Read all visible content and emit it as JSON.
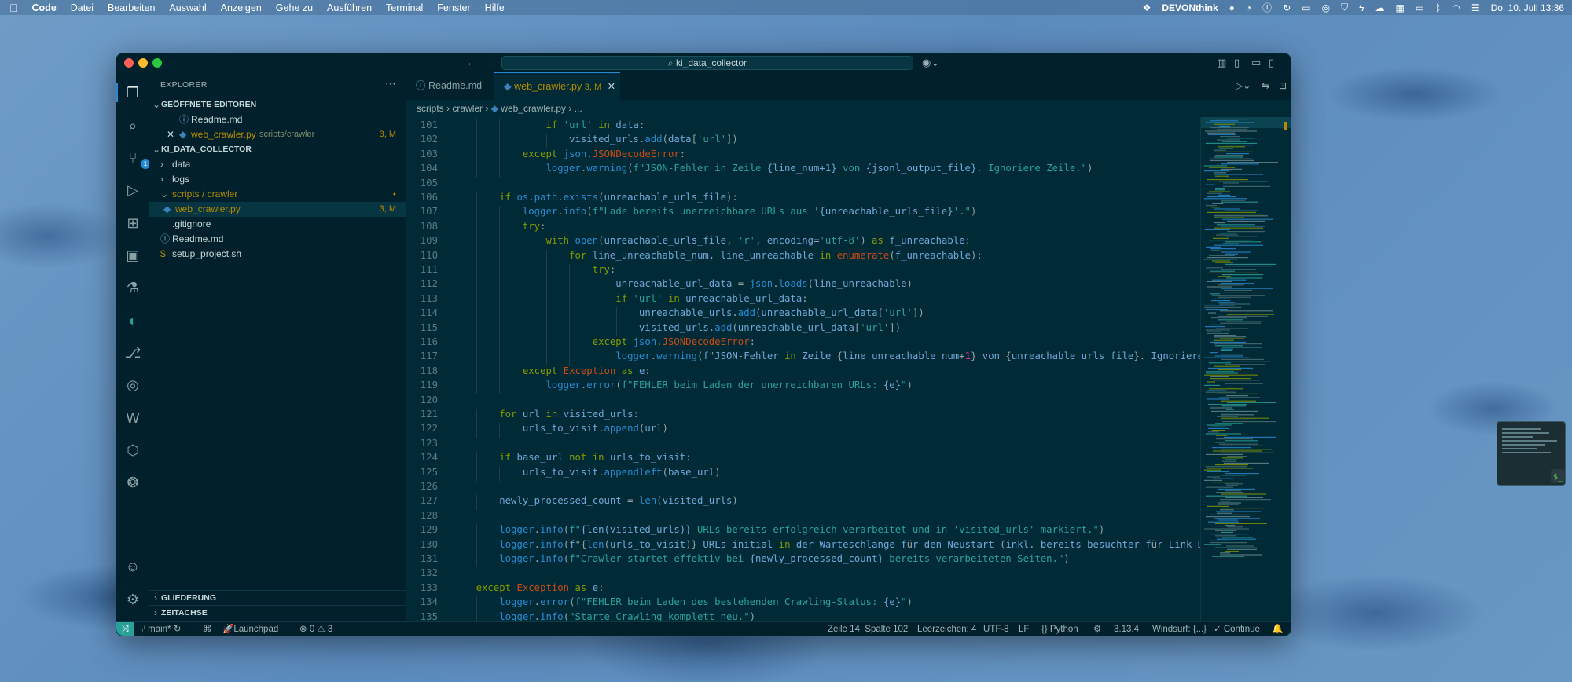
{
  "menubar": {
    "app": "Code",
    "menus": [
      "Datei",
      "Bearbeiten",
      "Auswahl",
      "Anzeigen",
      "Gehe zu",
      "Ausführen",
      "Terminal",
      "Fenster",
      "Hilfe"
    ],
    "devonthink": "DEVONthink",
    "clock": "Do. 10. Juli  13:36"
  },
  "window": {
    "command_center": "ki_data_collector"
  },
  "sidebar": {
    "title": "EXPLORER",
    "open_editors_label": "GEÖFFNETE EDITOREN",
    "open_editors": [
      {
        "name": "Readme.md",
        "path": "",
        "status": ""
      },
      {
        "name": "web_crawler.py",
        "path": "scripts/crawler",
        "status": "3, M"
      }
    ],
    "project_label": "KI_DATA_COLLECTOR",
    "tree": [
      {
        "name": "data",
        "status": ""
      },
      {
        "name": "logs",
        "status": ""
      },
      {
        "name": "scripts / crawler",
        "status": "●"
      },
      {
        "name": "web_crawler.py",
        "status": "3, M"
      },
      {
        "name": ".gitignore",
        "status": ""
      },
      {
        "name": "Readme.md",
        "status": ""
      },
      {
        "name": "setup_project.sh",
        "status": ""
      }
    ],
    "outline_label": "GLIEDERUNG",
    "timeline_label": "ZEITACHSE"
  },
  "tabs": [
    {
      "label": "Readme.md",
      "status": ""
    },
    {
      "label": "web_crawler.py",
      "status": "3, M"
    }
  ],
  "breadcrumb": {
    "seg1": "scripts",
    "seg2": "crawler",
    "seg3": "web_crawler.py",
    "seg4": "..."
  },
  "editor": {
    "line_numbers": [
      "101",
      "102",
      "103",
      "104",
      "105",
      "106",
      "107",
      "108",
      "109",
      "110",
      "111",
      "112",
      "113",
      "114",
      "115",
      "116",
      "117",
      "118",
      "119",
      "120",
      "121",
      "122",
      "123",
      "124",
      "125",
      "126",
      "127",
      "128",
      "129",
      "130",
      "131",
      "132",
      "133",
      "134",
      "135"
    ],
    "lines": [
      "                if 'url' in data:",
      "                    visited_urls.add(data['url'])",
      "            except json.JSONDecodeError:",
      "                logger.warning(f\"JSON-Fehler in Zeile {line_num+1} von {jsonl_output_file}. Ignoriere Zeile.\")",
      "",
      "        if os.path.exists(unreachable_urls_file):",
      "            logger.info(f\"Lade bereits unerreichbare URLs aus '{unreachable_urls_file}'.\")",
      "            try:",
      "                with open(unreachable_urls_file, 'r', encoding='utf-8') as f_unreachable:",
      "                    for line_unreachable_num, line_unreachable in enumerate(f_unreachable):",
      "                        try:",
      "                            unreachable_url_data = json.loads(line_unreachable)",
      "                            if 'url' in unreachable_url_data:",
      "                                unreachable_urls.add(unreachable_url_data['url'])",
      "                                visited_urls.add(unreachable_url_data['url'])",
      "                        except json.JSONDecodeError:",
      "                            logger.warning(f\"JSON-Fehler in Zeile {line_unreachable_num+1} von {unreachable_urls_file}. Ignoriere",
      "            except Exception as e:",
      "                logger.error(f\"FEHLER beim Laden der unerreichbaren URLs: {e}\")",
      "",
      "        for url in visited_urls:",
      "            urls_to_visit.append(url)",
      "",
      "        if base_url not in urls_to_visit:",
      "            urls_to_visit.appendleft(base_url)",
      "",
      "        newly_processed_count = len(visited_urls)",
      "",
      "        logger.info(f\"{len(visited_urls)} URLs bereits erfolgreich verarbeitet und in 'visited_urls' markiert.\")",
      "        logger.info(f\"{len(urls_to_visit)} URLs initial in der Warteschlange für den Neustart (inkl. bereits besuchter für Link-D",
      "        logger.info(f\"Crawler startet effektiv bei {newly_processed_count} bereits verarbeiteten Seiten.\")",
      "",
      "    except Exception as e:",
      "        logger.error(f\"FEHLER beim Laden des bestehenden Crawling-Status: {e}\")",
      "        logger.info(\"Starte Crawling komplett neu.\")"
    ]
  },
  "statusbar": {
    "branch": "main*",
    "launchpad": "Launchpad",
    "problems": "⊗ 0 ⚠ 3",
    "cursor": "Zeile 14, Spalte 102",
    "spaces": "Leerzeichen: 4",
    "encoding": "UTF-8",
    "eol": "LF",
    "language": "Python",
    "version": "3.13.4",
    "windsurf": "Windsurf: {...}",
    "continue": "Continue"
  },
  "colors": {
    "accent": "#268bd2",
    "modified": "#b58900",
    "keyword": "#859900",
    "string": "#2aa198"
  }
}
